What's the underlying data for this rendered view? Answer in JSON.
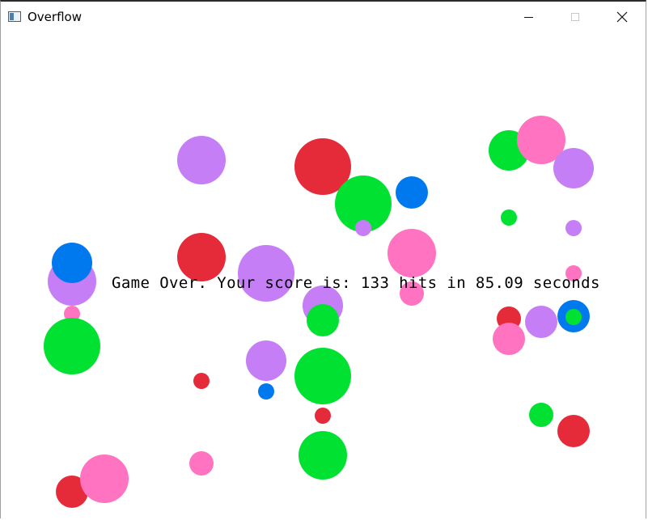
{
  "window": {
    "title": "Overflow",
    "icons": {
      "app": "window-app-icon",
      "minimize": "minimize-icon",
      "maximize": "maximize-icon",
      "close": "close-icon"
    }
  },
  "game": {
    "message": "Game Over. Your score is: 133 hits in 85.09 seconds",
    "score_hits": 133,
    "time_seconds": 85.09,
    "colors": {
      "red": "#e52b3a",
      "green": "#00e132",
      "blue": "#0079ef",
      "purple": "#c57ef5",
      "pink": "#ff73c0"
    }
  }
}
